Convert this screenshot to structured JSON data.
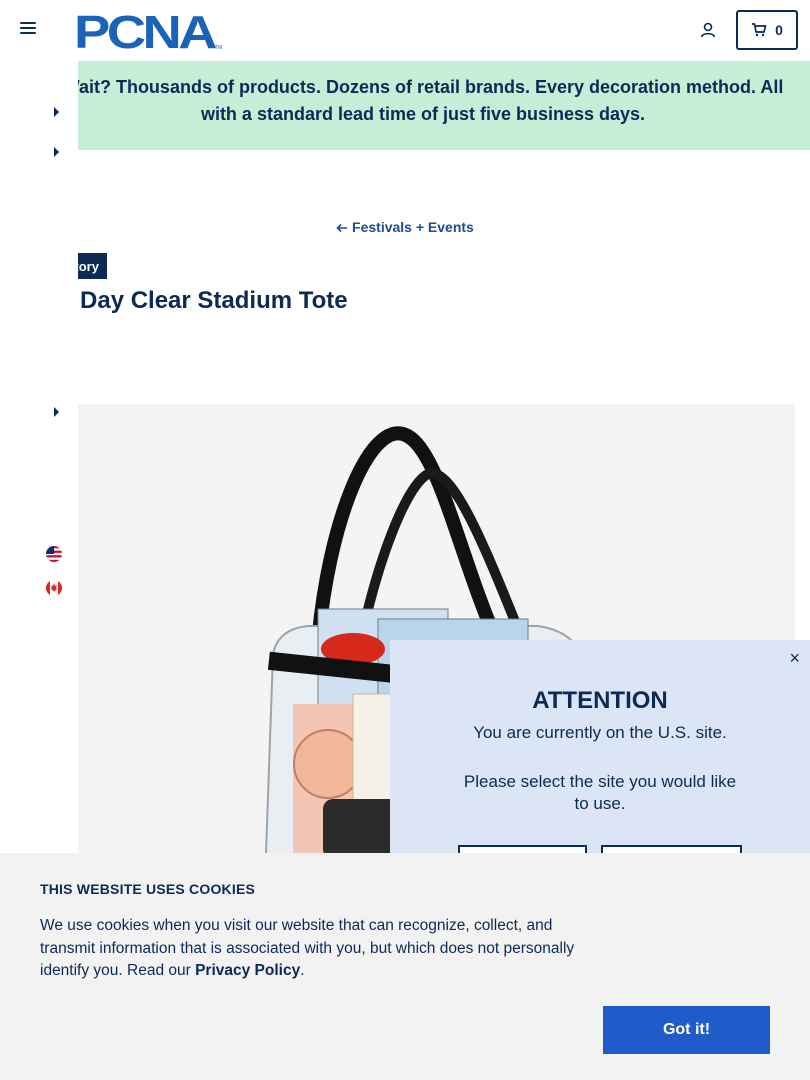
{
  "header": {
    "logo_text": "PCNA",
    "cart_count": "0"
  },
  "banner": {
    "text": "Wait? Thousands of products. Dozens of retail brands. Every decoration method. All with a standard lead time of just five business days."
  },
  "breadcrumb": {
    "label": "Festivals + Events"
  },
  "product": {
    "badge": "ventory",
    "title": "e Day Clear Stadium Tote"
  },
  "attention_popup": {
    "heading": "ATTENTION",
    "current_site": "You are currently on the U.S. site.",
    "prompt": "Please select the site you would like to use.",
    "close_symbol": "×"
  },
  "cookies": {
    "heading": "THIS WEBSITE USES COOKIES",
    "text_before": "We use cookies when you visit our website that can recognize, collect, and transmit information that is associated with you, but which does not personally identify you. Read our ",
    "link": "Privacy Policy",
    "text_after": ".",
    "button": "Got it!"
  },
  "colors": {
    "navy": "#0b2a55",
    "banner_green": "#c6eed6",
    "popup_blue": "#dbe5f5",
    "button_blue": "#1f5cc9"
  },
  "icons": [
    "hamburger-menu-icon",
    "account-icon",
    "cart-icon",
    "caret-right-icon",
    "us-flag-icon",
    "canada-flag-icon",
    "arrow-left-icon",
    "close-icon"
  ]
}
